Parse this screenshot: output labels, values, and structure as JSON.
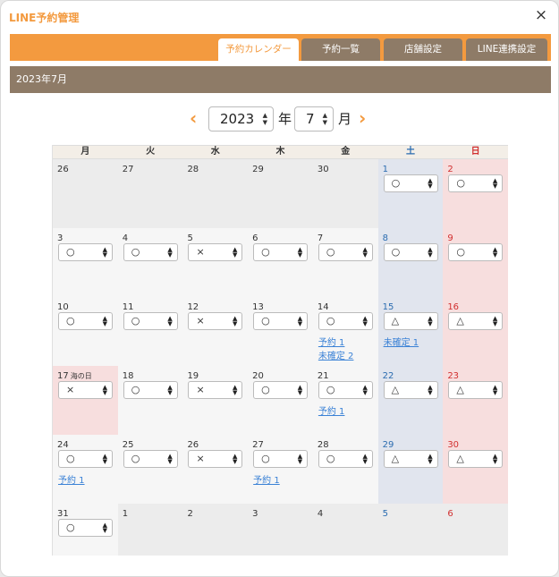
{
  "window": {
    "title": "LINE予約管理",
    "close_icon": "×"
  },
  "tabs": [
    {
      "label": "予約カレンダー",
      "active": true
    },
    {
      "label": "予約一覧",
      "active": false
    },
    {
      "label": "店舗設定",
      "active": false
    },
    {
      "label": "LINE連携設定",
      "active": false
    }
  ],
  "month_header": "2023年7月",
  "navigation": {
    "prev_icon": "‹",
    "next_icon": "›",
    "year_value": "2023",
    "year_suffix": "年",
    "month_value": "7",
    "month_suffix": "月"
  },
  "weekdays": [
    "月",
    "火",
    "水",
    "木",
    "金",
    "土",
    "日"
  ],
  "weeks": [
    [
      {
        "day": "26",
        "type": "off"
      },
      {
        "day": "27",
        "type": "off"
      },
      {
        "day": "28",
        "type": "off"
      },
      {
        "day": "29",
        "type": "off"
      },
      {
        "day": "30",
        "type": "off"
      },
      {
        "day": "1",
        "type": "sat",
        "status": "○"
      },
      {
        "day": "2",
        "type": "sun",
        "status": "○"
      }
    ],
    [
      {
        "day": "3",
        "status": "○"
      },
      {
        "day": "4",
        "status": "○"
      },
      {
        "day": "5",
        "status": "×"
      },
      {
        "day": "6",
        "status": "○"
      },
      {
        "day": "7",
        "status": "○"
      },
      {
        "day": "8",
        "type": "sat",
        "status": "○"
      },
      {
        "day": "9",
        "type": "sun",
        "status": "○"
      }
    ],
    [
      {
        "day": "10",
        "status": "○"
      },
      {
        "day": "11",
        "status": "○"
      },
      {
        "day": "12",
        "status": "×"
      },
      {
        "day": "13",
        "status": "○"
      },
      {
        "day": "14",
        "status": "○",
        "links": [
          "予約 1",
          "未確定 2"
        ]
      },
      {
        "day": "15",
        "type": "sat",
        "status": "△",
        "links": [
          "未確定 1"
        ]
      },
      {
        "day": "16",
        "type": "sun",
        "status": "△"
      }
    ],
    [
      {
        "day": "17",
        "type": "holiday",
        "holiday": "海の日",
        "status": "×"
      },
      {
        "day": "18",
        "status": "○"
      },
      {
        "day": "19",
        "status": "×"
      },
      {
        "day": "20",
        "status": "○"
      },
      {
        "day": "21",
        "status": "○",
        "links": [
          "予約 1"
        ]
      },
      {
        "day": "22",
        "type": "sat",
        "status": "△"
      },
      {
        "day": "23",
        "type": "sun",
        "status": "△"
      }
    ],
    [
      {
        "day": "24",
        "status": "○",
        "links": [
          "予約 1"
        ]
      },
      {
        "day": "25",
        "status": "○"
      },
      {
        "day": "26",
        "status": "×"
      },
      {
        "day": "27",
        "status": "○",
        "links": [
          "予約 1"
        ]
      },
      {
        "day": "28",
        "status": "○"
      },
      {
        "day": "29",
        "type": "sat",
        "status": "△"
      },
      {
        "day": "30",
        "type": "sun",
        "status": "△"
      }
    ],
    [
      {
        "day": "31",
        "status": "○"
      },
      {
        "day": "1",
        "type": "off"
      },
      {
        "day": "2",
        "type": "off"
      },
      {
        "day": "3",
        "type": "off"
      },
      {
        "day": "4",
        "type": "off"
      },
      {
        "day": "5",
        "type": "off-sat"
      },
      {
        "day": "6",
        "type": "off-sun"
      }
    ]
  ],
  "colors": {
    "accent": "#f39a3f",
    "header_brown": "#8e7b67",
    "link": "#3b82d6",
    "saturday": "#2b6cb0",
    "sunday": "#d12f2f"
  }
}
